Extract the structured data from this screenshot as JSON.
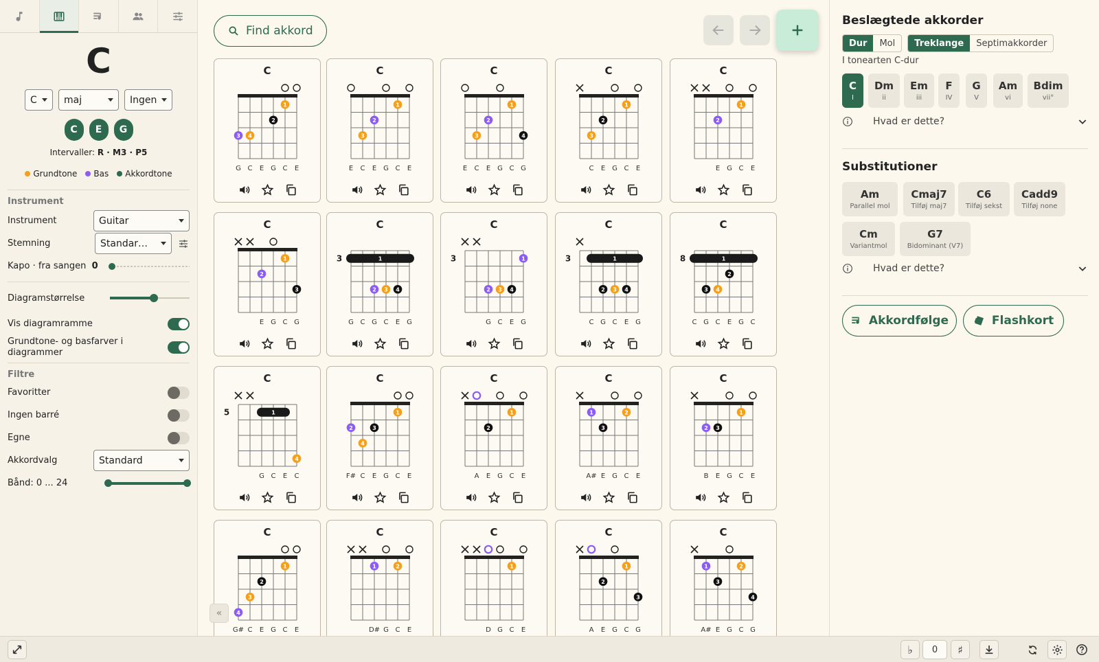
{
  "left": {
    "tabs": [
      "music-note-icon",
      "piano-icon",
      "playlist-icon",
      "people-icon",
      "sliders-icon"
    ],
    "active_tab": 1,
    "chord_name": "C",
    "root_value": "C",
    "quality_value": "maj",
    "bass_value": "Ingen",
    "notes": [
      "C",
      "E",
      "G"
    ],
    "intervals_label": "Intervaller:",
    "intervals_value": "R · M3 · P5",
    "legend": [
      {
        "label": "Grundtone",
        "color": "#f5a01a"
      },
      {
        "label": "Bas",
        "color": "#8b5cf6"
      },
      {
        "label": "Akkordtone",
        "color": "#2d6a4f"
      }
    ],
    "instrument_section": {
      "heading": "Instrument",
      "instrument_label": "Instrument",
      "instrument_value": "Guitar",
      "tuning_label": "Stemning",
      "tuning_value": "Standar…",
      "capo_label": "Kapo · fra sangen",
      "capo_value": "0",
      "diagram_size_label": "Diagramstørrelse",
      "diagram_size_value": 0.55,
      "show_frame_label": "Vis diagramramme",
      "root_colors_label": "Grundtone- og basfarver i diagrammer"
    },
    "filters_section": {
      "heading": "Filtre",
      "favorites_label": "Favoritter",
      "no_barre_label": "Ingen barré",
      "own_label": "Egne",
      "chord_choice_label": "Akkordvalg",
      "chord_choice_value": "Standard",
      "frets_label": "Bånd: 0 ... 24",
      "fret_range": [
        0,
        24
      ]
    }
  },
  "center": {
    "search_label": "Find akkord",
    "cards": [
      {
        "name": "C",
        "base": 0,
        "mk": [
          "",
          "",
          "",
          "",
          "o",
          "o"
        ],
        "dots": [
          [
            1,
            5,
            "1",
            "r"
          ],
          [
            2,
            4,
            "2",
            "t"
          ],
          [
            3,
            1,
            "3",
            "b"
          ],
          [
            3,
            2,
            "4",
            "r"
          ]
        ],
        "labels": [
          "G",
          "C",
          "E",
          "G",
          "C",
          "E"
        ]
      },
      {
        "name": "C",
        "base": 0,
        "mk": [
          "o",
          "",
          "",
          "o",
          "",
          "o"
        ],
        "dots": [
          [
            1,
            5,
            "1",
            "r"
          ],
          [
            2,
            3,
            "2",
            "b"
          ],
          [
            3,
            2,
            "3",
            "r"
          ]
        ],
        "labels": [
          "E",
          "C",
          "E",
          "G",
          "C",
          "E"
        ]
      },
      {
        "name": "C",
        "base": 0,
        "mk": [
          "o",
          "",
          "",
          "o",
          "",
          ""
        ],
        "dots": [
          [
            1,
            5,
            "1",
            "r"
          ],
          [
            2,
            3,
            "2",
            "b"
          ],
          [
            3,
            2,
            "3",
            "r"
          ],
          [
            3,
            6,
            "4",
            "t"
          ]
        ],
        "labels": [
          "E",
          "C",
          "E",
          "G",
          "C",
          "G"
        ]
      },
      {
        "name": "C",
        "base": 0,
        "mk": [
          "x",
          "",
          "",
          "o",
          "",
          "o"
        ],
        "dots": [
          [
            1,
            5,
            "1",
            "r"
          ],
          [
            2,
            3,
            "2",
            "t"
          ],
          [
            3,
            2,
            "3",
            "r"
          ]
        ],
        "labels": [
          "",
          "C",
          "E",
          "G",
          "C",
          "E"
        ]
      },
      {
        "name": "C",
        "base": 0,
        "mk": [
          "x",
          "x",
          "",
          "o",
          "",
          "o"
        ],
        "dots": [
          [
            1,
            5,
            "1",
            "r"
          ],
          [
            2,
            3,
            "2",
            "b"
          ]
        ],
        "labels": [
          "",
          "",
          "E",
          "G",
          "C",
          "E"
        ]
      },
      {
        "name": "C",
        "base": 0,
        "mk": [
          "x",
          "x",
          "",
          "o",
          "",
          ""
        ],
        "dots": [
          [
            1,
            5,
            "1",
            "r"
          ],
          [
            2,
            3,
            "2",
            "b"
          ],
          [
            3,
            6,
            "3",
            "t"
          ]
        ],
        "labels": [
          "",
          "",
          "E",
          "G",
          "C",
          "G"
        ]
      },
      {
        "name": "C",
        "base": 3,
        "mk": [
          "",
          "",
          "",
          "",
          "",
          ""
        ],
        "barre": [
          1,
          1,
          6
        ],
        "dots": [
          [
            3,
            3,
            "2",
            "b"
          ],
          [
            3,
            4,
            "3",
            "r"
          ],
          [
            3,
            5,
            "4",
            "t"
          ]
        ],
        "labels": [
          "G",
          "C",
          "G",
          "C",
          "E",
          "G"
        ]
      },
      {
        "name": "C",
        "base": 3,
        "mk": [
          "x",
          "x",
          "",
          "",
          "",
          ""
        ],
        "dots": [
          [
            1,
            6,
            "1",
            "b"
          ],
          [
            3,
            3,
            "2",
            "b"
          ],
          [
            3,
            4,
            "3",
            "r"
          ],
          [
            3,
            5,
            "4",
            "t"
          ]
        ],
        "labels": [
          "",
          "",
          "G",
          "C",
          "E",
          "G"
        ]
      },
      {
        "name": "C",
        "base": 3,
        "mk": [
          "x",
          "",
          "",
          "",
          "",
          ""
        ],
        "barre": [
          1,
          2,
          6
        ],
        "dots": [
          [
            3,
            3,
            "2",
            "t"
          ],
          [
            3,
            4,
            "3",
            "r"
          ],
          [
            3,
            5,
            "4",
            "t"
          ]
        ],
        "labels": [
          "",
          "C",
          "G",
          "C",
          "E",
          "G"
        ]
      },
      {
        "name": "C",
        "base": 8,
        "mk": [
          "",
          "",
          "",
          "",
          "",
          ""
        ],
        "barre": [
          1,
          1,
          6
        ],
        "dots": [
          [
            2,
            4,
            "2",
            "t"
          ],
          [
            3,
            2,
            "3",
            "t"
          ],
          [
            3,
            3,
            "4",
            "r"
          ]
        ],
        "labels": [
          "C",
          "G",
          "C",
          "E",
          "G",
          "C"
        ]
      },
      {
        "name": "C",
        "base": 5,
        "mk": [
          "x",
          "x",
          "",
          "",
          "",
          ""
        ],
        "barre": [
          1,
          3,
          5
        ],
        "dots": [
          [
            4,
            6,
            "4",
            "r"
          ]
        ],
        "labels": [
          "",
          "",
          "G",
          "C",
          "E",
          "C"
        ]
      },
      {
        "name": "C",
        "base": 0,
        "mk": [
          "",
          "",
          "",
          "",
          "o",
          "o"
        ],
        "dots": [
          [
            1,
            5,
            "1",
            "r"
          ],
          [
            2,
            1,
            "2",
            "b"
          ],
          [
            2,
            3,
            "3",
            "t"
          ],
          [
            3,
            2,
            "4",
            "r"
          ]
        ],
        "labels": [
          "F#",
          "C",
          "E",
          "G",
          "C",
          "E"
        ]
      },
      {
        "name": "C",
        "base": 0,
        "mk": [
          "x",
          "O",
          "",
          "o",
          "",
          "o"
        ],
        "dots": [
          [
            1,
            5,
            "1",
            "r"
          ],
          [
            2,
            3,
            "2",
            "t"
          ]
        ],
        "labels": [
          "",
          "A",
          "E",
          "G",
          "C",
          "E"
        ]
      },
      {
        "name": "C",
        "base": 0,
        "mk": [
          "x",
          "",
          "",
          "o",
          "",
          "o"
        ],
        "dots": [
          [
            1,
            2,
            "1",
            "b"
          ],
          [
            1,
            5,
            "2",
            "r"
          ],
          [
            2,
            3,
            "3",
            "t"
          ]
        ],
        "labels": [
          "",
          "A#",
          "E",
          "G",
          "C",
          "E"
        ]
      },
      {
        "name": "C",
        "base": 0,
        "mk": [
          "x",
          "",
          "",
          "o",
          "",
          "o"
        ],
        "dots": [
          [
            1,
            5,
            "1",
            "r"
          ],
          [
            2,
            2,
            "2",
            "b"
          ],
          [
            2,
            3,
            "3",
            "t"
          ]
        ],
        "labels": [
          "",
          "B",
          "E",
          "G",
          "C",
          "E"
        ]
      },
      {
        "name": "C",
        "base": 0,
        "mk": [
          "",
          "",
          "",
          "",
          "o",
          "o"
        ],
        "dots": [
          [
            1,
            5,
            "1",
            "r"
          ],
          [
            2,
            3,
            "2",
            "t"
          ],
          [
            3,
            2,
            "3",
            "r"
          ],
          [
            4,
            1,
            "4",
            "b"
          ]
        ],
        "labels": [
          "G#",
          "C",
          "E",
          "G",
          "C",
          "E"
        ]
      },
      {
        "name": "C",
        "base": 0,
        "mk": [
          "x",
          "x",
          "",
          "o",
          "",
          "o"
        ],
        "dots": [
          [
            1,
            3,
            "1",
            "b"
          ],
          [
            1,
            5,
            "2",
            "r"
          ]
        ],
        "labels": [
          "",
          "",
          "D#",
          "G",
          "C",
          "E"
        ]
      },
      {
        "name": "C",
        "base": 0,
        "mk": [
          "x",
          "x",
          "O",
          "o",
          "",
          "o"
        ],
        "dots": [
          [
            1,
            5,
            "1",
            "r"
          ]
        ],
        "labels": [
          "",
          "",
          "D",
          "G",
          "C",
          "E"
        ]
      },
      {
        "name": "C",
        "base": 0,
        "mk": [
          "x",
          "O",
          "",
          "o",
          "",
          ""
        ],
        "dots": [
          [
            1,
            5,
            "1",
            "r"
          ],
          [
            2,
            3,
            "2",
            "t"
          ],
          [
            3,
            6,
            "3",
            "t"
          ]
        ],
        "labels": [
          "",
          "A",
          "E",
          "G",
          "C",
          "G"
        ]
      },
      {
        "name": "C",
        "base": 0,
        "mk": [
          "x",
          "",
          "",
          "o",
          "",
          ""
        ],
        "dots": [
          [
            1,
            2,
            "1",
            "b"
          ],
          [
            1,
            5,
            "2",
            "r"
          ],
          [
            2,
            3,
            "3",
            "t"
          ],
          [
            3,
            6,
            "4",
            "t"
          ]
        ],
        "labels": [
          "",
          "A#",
          "E",
          "G",
          "C",
          "G"
        ]
      }
    ]
  },
  "right": {
    "related_title": "Beslægtede akkorder",
    "mode_options": [
      "Dur",
      "Mol"
    ],
    "mode_selected": "Dur",
    "type_options": [
      "Treklange",
      "Septimakkorder"
    ],
    "type_selected": "Treklange",
    "key_label": "I tonearten C-dur",
    "diatonic": [
      {
        "chord": "C",
        "degree": "I",
        "active": true
      },
      {
        "chord": "Dm",
        "degree": "ii"
      },
      {
        "chord": "Em",
        "degree": "iii"
      },
      {
        "chord": "F",
        "degree": "IV"
      },
      {
        "chord": "G",
        "degree": "V"
      },
      {
        "chord": "Am",
        "degree": "vi"
      },
      {
        "chord": "Bdim",
        "degree": "vii°"
      }
    ],
    "what_is_this": "Hvad er dette?",
    "substitutions_title": "Substitutioner",
    "substitutions": [
      {
        "chord": "Am",
        "desc": "Parallel mol"
      },
      {
        "chord": "Cmaj7",
        "desc": "Tilføj maj7"
      },
      {
        "chord": "C6",
        "desc": "Tilføj sekst"
      },
      {
        "chord": "Cadd9",
        "desc": "Tilføj none"
      },
      {
        "chord": "Cm",
        "desc": "Variantmol"
      },
      {
        "chord": "G7",
        "desc": "Bidominant (V7)"
      }
    ],
    "progression_label": "Akkordfølge",
    "flashcard_label": "Flashkort"
  },
  "bottom": {
    "flat": "♭",
    "transpose_value": "0",
    "sharp": "♯"
  },
  "colors": {
    "accent": "#2d6a4f",
    "root": "#f5a01a",
    "bass": "#8b5cf6",
    "tone": "#111111"
  }
}
